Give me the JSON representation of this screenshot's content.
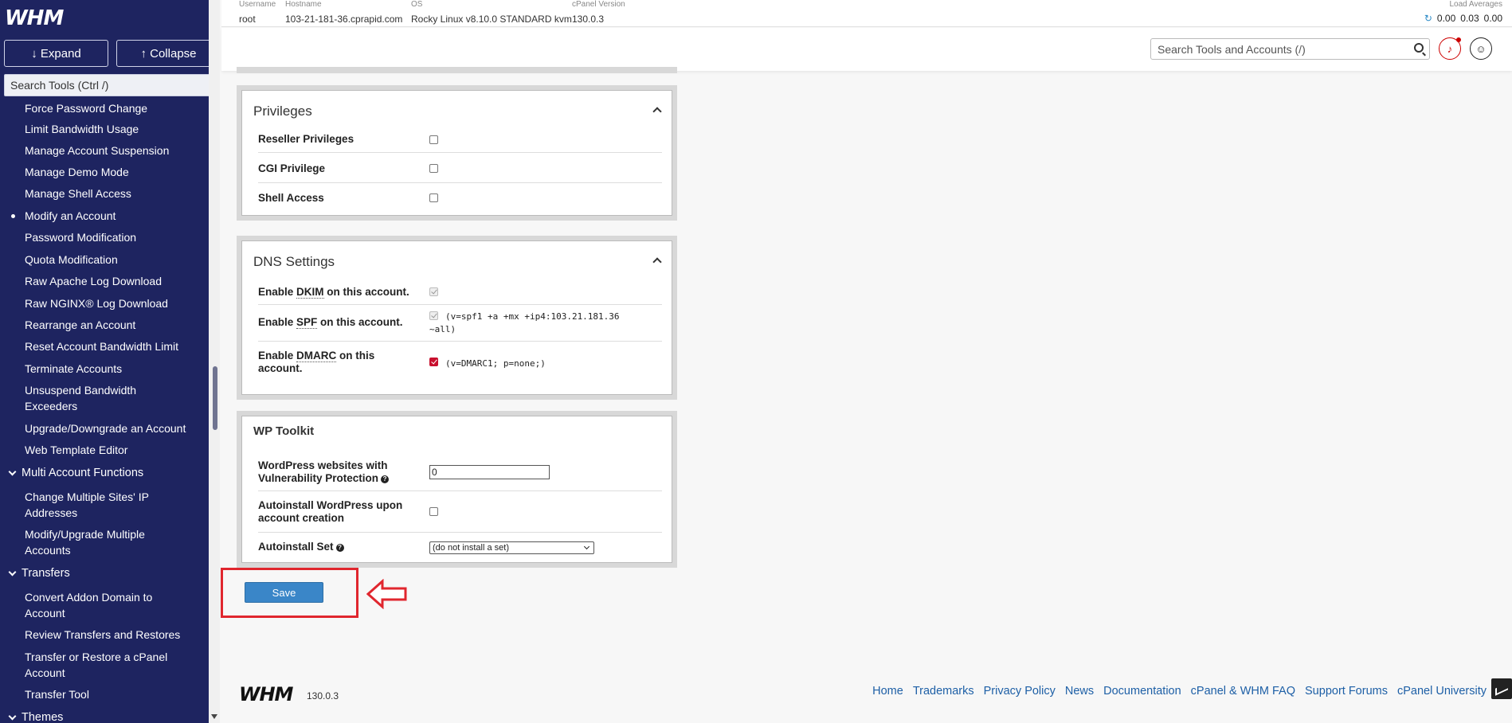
{
  "sidebar": {
    "logo": "WHM",
    "expand_label": "↓ Expand",
    "collapse_label": "↑ Collapse",
    "search_placeholder": "Search Tools (Ctrl /)",
    "items": [
      {
        "label": "Force Password Change"
      },
      {
        "label": "Limit Bandwidth Usage"
      },
      {
        "label": "Manage Account Suspension"
      },
      {
        "label": "Manage Demo Mode"
      },
      {
        "label": "Manage Shell Access"
      },
      {
        "label": "Modify an Account",
        "active": true
      },
      {
        "label": "Password Modification"
      },
      {
        "label": "Quota Modification"
      },
      {
        "label": "Raw Apache Log Download"
      },
      {
        "label": "Raw NGINX® Log Download"
      },
      {
        "label": "Rearrange an Account"
      },
      {
        "label": "Reset Account Bandwidth Limit"
      },
      {
        "label": "Terminate Accounts"
      },
      {
        "label": "Unsuspend Bandwidth Exceeders"
      },
      {
        "label": "Upgrade/Downgrade an Account"
      },
      {
        "label": "Web Template Editor"
      }
    ],
    "group_multi": "Multi Account Functions",
    "multi_items": [
      {
        "label": "Change Multiple Sites' IP Addresses"
      },
      {
        "label": "Modify/Upgrade Multiple Accounts"
      }
    ],
    "group_transfers": "Transfers",
    "transfer_items": [
      {
        "label": "Convert Addon Domain to Account"
      },
      {
        "label": "Review Transfers and Restores"
      },
      {
        "label": "Transfer or Restore a cPanel Account"
      },
      {
        "label": "Transfer Tool"
      }
    ],
    "group_themes": "Themes"
  },
  "topbar": {
    "username_label": "Username",
    "username": "root",
    "hostname_label": "Hostname",
    "hostname": "103-21-181-36.cprapid.com",
    "os_label": "OS",
    "os": "Rocky Linux v8.10.0 STANDARD kvm",
    "cpanel_label": "cPanel Version",
    "cpanel": "130.0.3",
    "load_label": "Load Averages",
    "load": [
      "0.00",
      "0.03",
      "0.00"
    ],
    "search_placeholder": "Search Tools and Accounts (/)"
  },
  "privileges": {
    "title": "Privileges",
    "rows": [
      {
        "label": "Reseller Privileges",
        "checked": false
      },
      {
        "label": "CGI Privilege",
        "checked": false
      },
      {
        "label": "Shell Access",
        "checked": false
      }
    ]
  },
  "dns": {
    "title": "DNS Settings",
    "dkim_pre": "Enable ",
    "dkim_abbr": "DKIM",
    "dkim_post": " on this account.",
    "spf_pre": "Enable ",
    "spf_abbr": "SPF",
    "spf_post": " on this account.",
    "spf_value_1": "(v=spf1 +a +mx +ip4:103.21.181.36",
    "spf_value_2": "~all)",
    "dmarc_pre": "Enable ",
    "dmarc_abbr": "DMARC",
    "dmarc_post": " on this",
    "dmarc_line2": "account.",
    "dmarc_value": "(v=DMARC1; p=none;)"
  },
  "wp": {
    "title": "WP Toolkit",
    "vuln_line1": "WordPress websites with",
    "vuln_line2": "Vulnerability Protection",
    "vuln_value": "0",
    "autoinstall_line1": "Autoinstall WordPress upon",
    "autoinstall_line2": "account creation",
    "set_label": "Autoinstall Set",
    "set_value": "(do not install a set)"
  },
  "save_label": "Save",
  "footer": {
    "logo": "WHM",
    "version": "130.0.3",
    "links": [
      "Home",
      "Trademarks",
      "Privacy Policy",
      "News",
      "Documentation",
      "cPanel & WHM FAQ",
      "Support Forums",
      "cPanel University"
    ]
  },
  "colors": {
    "sidebar_bg": "#1e2460",
    "save": "#3a86c8",
    "highlight": "#e0262e"
  }
}
